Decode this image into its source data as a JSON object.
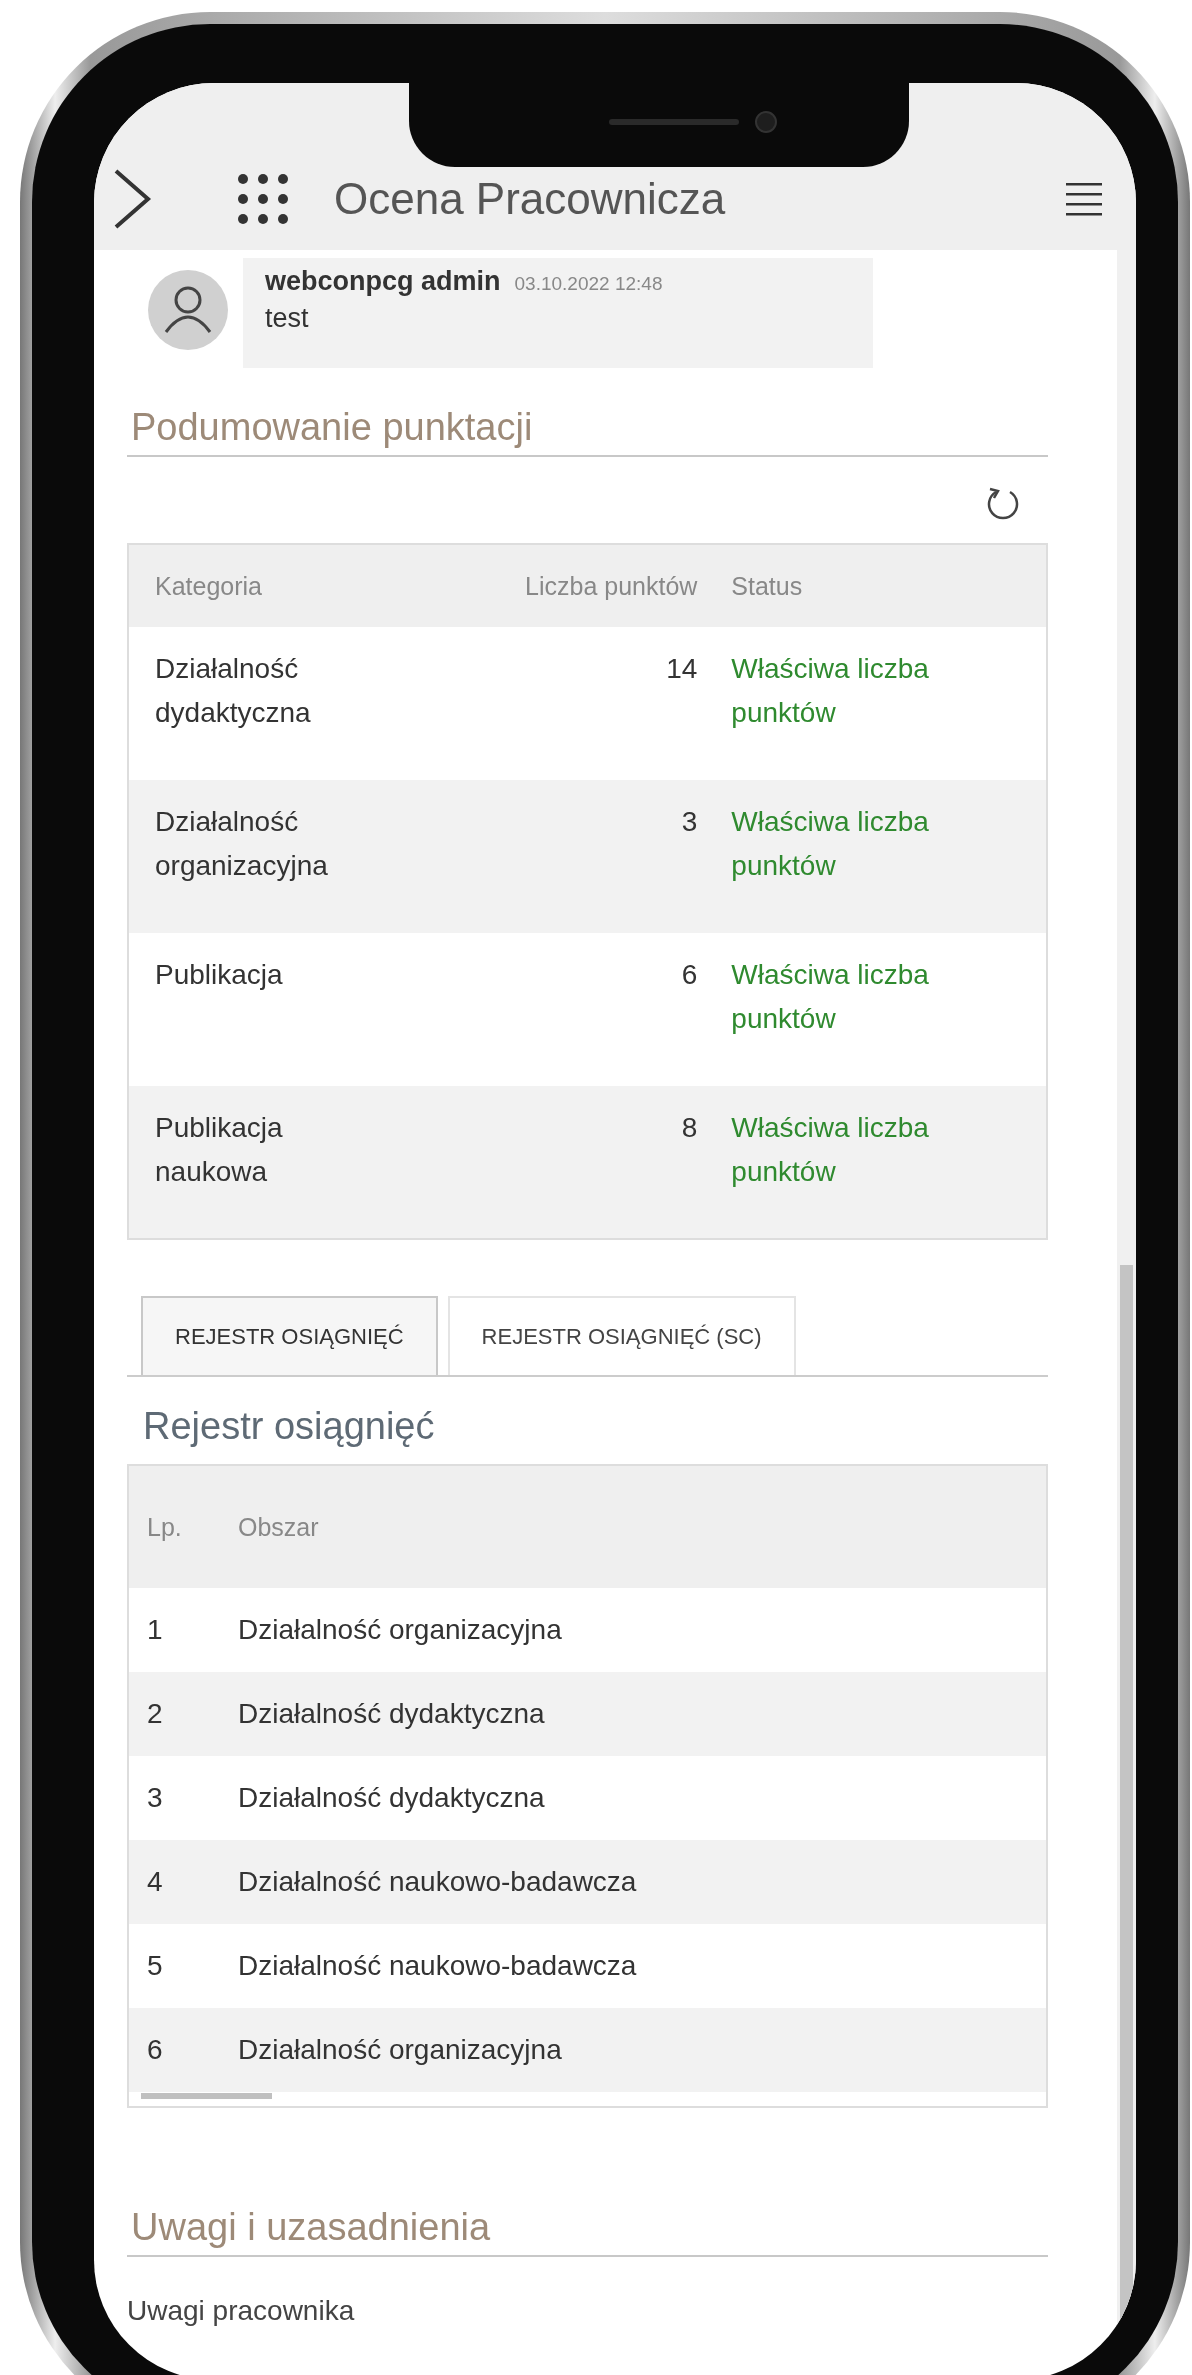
{
  "header": {
    "title": "Ocena Pracownicza"
  },
  "comment": {
    "author": "webconpcg admin",
    "timestamp": "03.10.2022 12:48",
    "text": "test"
  },
  "summary": {
    "title": "Podumowanie punktacji",
    "columns": [
      "Kategoria",
      "Liczba punktów",
      "Status"
    ],
    "rows": [
      {
        "category": "Działalność dydaktyczna",
        "points": "14",
        "status": "Właściwa liczba punktów"
      },
      {
        "category": "Działalność organizacyjna",
        "points": "3",
        "status": "Właściwa liczba punktów"
      },
      {
        "category": "Publikacja",
        "points": "6",
        "status": "Właściwa liczba punktów"
      },
      {
        "category": "Publikacja naukowa",
        "points": "8",
        "status": "Właściwa liczba punktów"
      }
    ]
  },
  "tabs": [
    {
      "label": "REJESTR OSIĄGNIĘĆ",
      "selected": true
    },
    {
      "label": "REJESTR OSIĄGNIĘĆ (SC)",
      "selected": false
    }
  ],
  "register": {
    "title": "Rejestr osiągnięć",
    "columns": [
      "Lp.",
      "Obszar"
    ],
    "rows": [
      {
        "lp": "1",
        "area": "Działalność organizacyjna"
      },
      {
        "lp": "2",
        "area": "Działalność dydaktyczna"
      },
      {
        "lp": "3",
        "area": "Działalność dydaktyczna"
      },
      {
        "lp": "4",
        "area": "Działalność naukowo-badawcza"
      },
      {
        "lp": "5",
        "area": "Działalność naukowo-badawcza"
      },
      {
        "lp": "6",
        "area": "Działalność organizacyjna"
      }
    ]
  },
  "remarks": {
    "title": "Uwagi i uzasadnienia",
    "field_label": "Uwagi pracownika"
  }
}
